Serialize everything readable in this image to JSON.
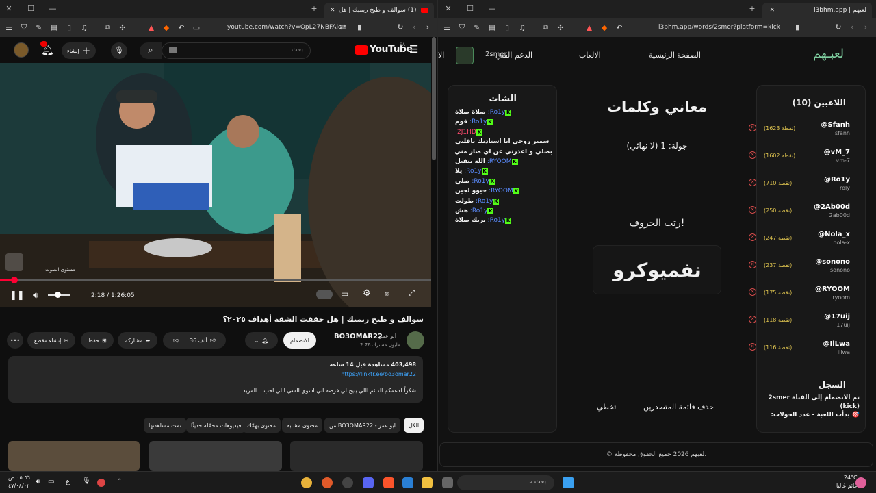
{
  "left": {
    "tab_title": "(1) سوالف و طبخ ريميك | هل ح...",
    "url": "youtube.com/watch?v=OpL27NBFAlc",
    "yt": {
      "logo": "YouTube",
      "country": "SA",
      "search_placeholder": "بحث",
      "create_label": "إنشاء",
      "notif_count": "1",
      "video_title": "سوالف و طبخ ريميك | هل حققت الشقة أهداف ٢٠٢٥؟",
      "channel": "BO3OMAR22",
      "channel_alt": "ابو عمر",
      "subs": "2.76 مليون مشترك",
      "join_label": "الانضمام",
      "likes": "36 ألف",
      "share_label": "مشاركة",
      "save_label": "حفظ",
      "clip_label": "إنشاء مقطع",
      "time": "2:18 / 1:26:05",
      "volume_hint": "مستوى الصوت",
      "views": "403,498 مشاهدة قبل 14 ساعة",
      "link": "https://linktr.ee/bo3omar22",
      "desc_text": "شكراً لدعمكم الدائم اللي يتيح لي فرصة اني اسوي الشي اللي احب ...المزيد",
      "chips": [
        "الكل",
        "من BO3OMAR22 - ابو عمر",
        "محتوى مشابه",
        "محتوى بهمّك",
        "فيديوهات محمّلة حديثًا",
        "تمت مشاهدتها"
      ],
      "progress": 0.027
    }
  },
  "right": {
    "tab_title": "لعبهم | i3bhm.app",
    "url": "l3bhm.app/words/2smer?platform=kick",
    "logo": "لعبـهم",
    "nav": [
      "الصفحة الرئيسية",
      "الالعاب",
      "الدعم الفني",
      "الا"
    ],
    "user": "2smer",
    "players_title": "اللاعبين (10)",
    "players": [
      {
        "name": "@Sfanh",
        "user": "sfanh",
        "pts": "(1623 نقطة)"
      },
      {
        "name": "@vM_7",
        "user": "vm-7",
        "pts": "(1602 نقطة)"
      },
      {
        "name": "@Ro1y",
        "user": "roly",
        "pts": "(710 نقطة)"
      },
      {
        "name": "@2Ab00d",
        "user": "2ab00d",
        "pts": "(250 نقطة)"
      },
      {
        "name": "@Nola_x",
        "user": "nola-x",
        "pts": "(247 نقطة)"
      },
      {
        "name": "@sonono",
        "user": "sonono",
        "pts": "(237 نقطة)"
      },
      {
        "name": "@RYOOM",
        "user": "ryoom",
        "pts": "(175 نقطة)"
      },
      {
        "name": "@17uij",
        "user": "17uij",
        "pts": "(118 نقطة)"
      },
      {
        "name": "@IlLwa",
        "user": "illwa",
        "pts": "(116 نقطة)"
      }
    ],
    "log_title": "السجل",
    "log": [
      "تم الانضمام إلى القناة 2smer (kick)",
      "🎯 بدأت اللعبة - عدد الجولات:"
    ],
    "game_title": "معاني وكلمات",
    "round": "جولة: 1 (لا نهائي)",
    "prompt": "رتب الحروف!",
    "word": "نفميوكرو",
    "clear_label": "حذف قائمة المتصدرين",
    "skip_label": "تخطي",
    "chat_title": "الشات",
    "chat": [
      {
        "user": "Ro1y:",
        "msg": "صلاة صلاة",
        "color": "#5b8cff"
      },
      {
        "user": "Ro1y:",
        "msg": "قوم",
        "color": "#5b8cff"
      },
      {
        "user": "2J1HD:",
        "msg": "",
        "color": "#ff4b6e"
      },
      {
        "user": "",
        "msg": "سمير روحي انا استاذنك باقلبي",
        "color": "#ffffff"
      },
      {
        "user": "",
        "msg": "بصلي و اعذرني عن اي صار مني",
        "color": "#ffffff"
      },
      {
        "user": "RYOOM:",
        "msg": "الله يتقبل",
        "color": "#5b8cff"
      },
      {
        "user": "Ro1y:",
        "msg": "يلا",
        "color": "#5b8cff"
      },
      {
        "user": "Ro1y:",
        "msg": "صلي",
        "color": "#5b8cff"
      },
      {
        "user": "RYOOM:",
        "msg": "حيوو لجين",
        "color": "#5b8cff"
      },
      {
        "user": "Ro1y:",
        "msg": "طولت",
        "color": "#5b8cff"
      },
      {
        "user": "Ro1y:",
        "msg": "هش",
        "color": "#5b8cff"
      },
      {
        "user": "Ro1y:",
        "msg": "بريك صلاة",
        "color": "#5b8cff"
      }
    ],
    "footer": "© لعبهم 2026 جميع الحقوق محفوظة."
  },
  "taskbar": {
    "search": "بحث",
    "weather_temp": "24°C",
    "weather_desc": "غائم غالبا",
    "time": "٠٥:٥٦ ص",
    "date": "٤٧/٠٨/٠٢",
    "lang": "ع"
  }
}
